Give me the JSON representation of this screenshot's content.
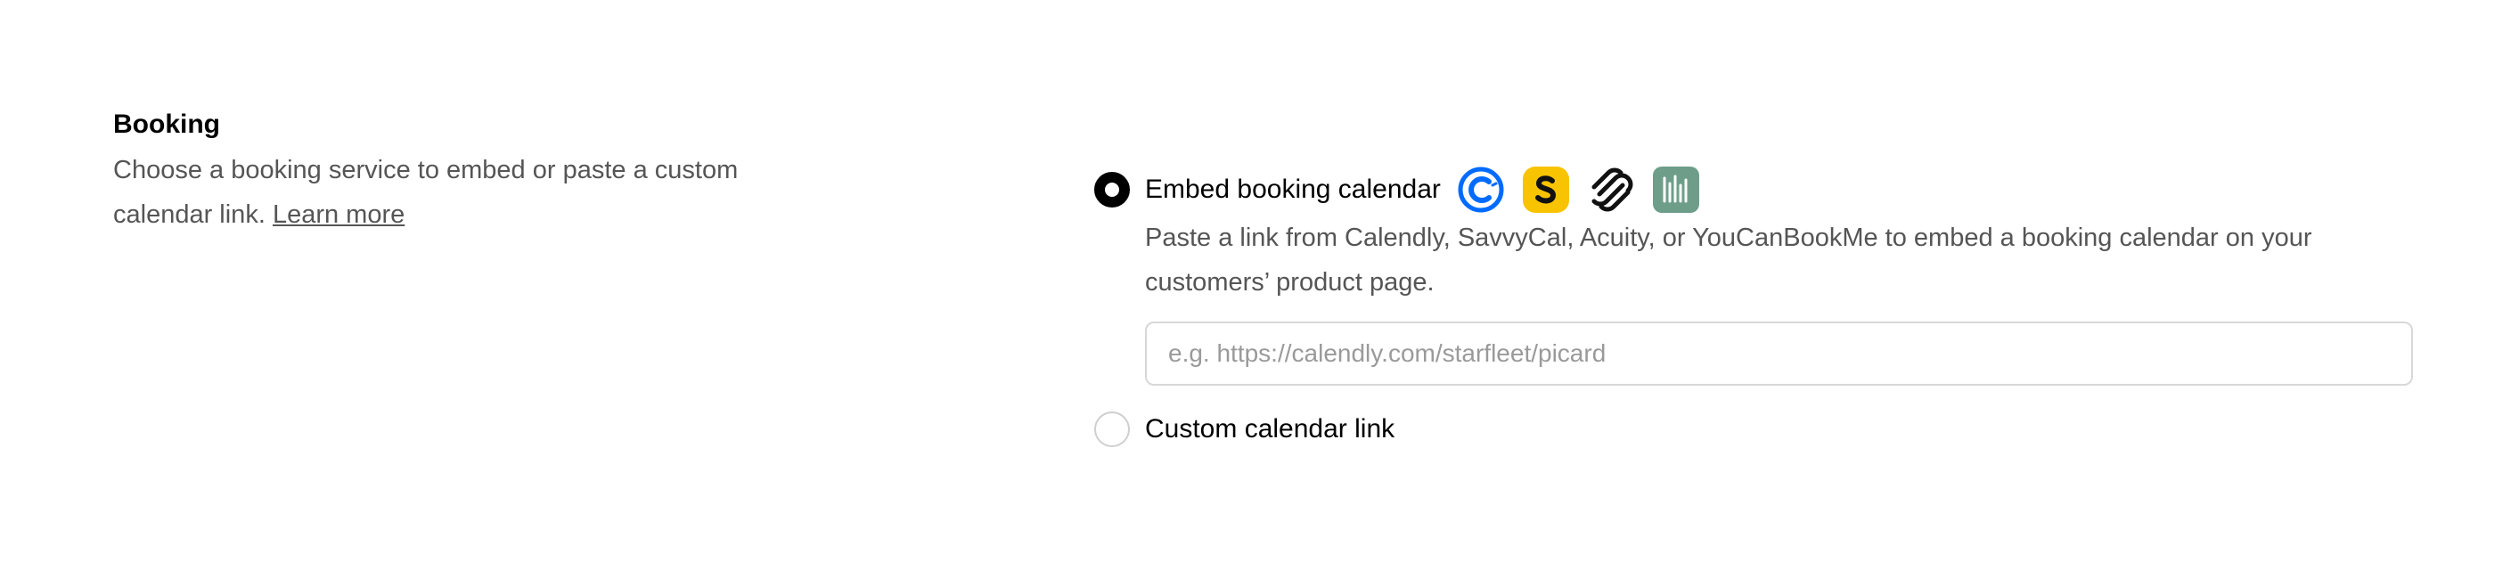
{
  "booking": {
    "title": "Booking",
    "description": "Choose a booking service to embed or paste a custom calendar link.",
    "learn_more": "Learn more"
  },
  "options": {
    "embed": {
      "label": "Embed booking calendar",
      "selected": true,
      "description": "Paste a link from Calendly, SavvyCal, Acuity, or YouCanBookMe to embed a booking calendar on your customers’ product page.",
      "input_placeholder": "e.g. https://calendly.com/starfleet/picard",
      "input_value": "",
      "service_icons": [
        "calendly-icon",
        "savvycal-icon",
        "acuity-icon",
        "youcanbookme-icon"
      ]
    },
    "custom": {
      "label": "Custom calendar link",
      "selected": false
    }
  },
  "colors": {
    "calendly_blue": "#006BFF",
    "savvycal_yellow": "#F8C300",
    "youcanbookme_green": "#6E9E8A",
    "text_primary": "#000000",
    "text_secondary": "#555555",
    "input_border": "#d8d8d8"
  }
}
